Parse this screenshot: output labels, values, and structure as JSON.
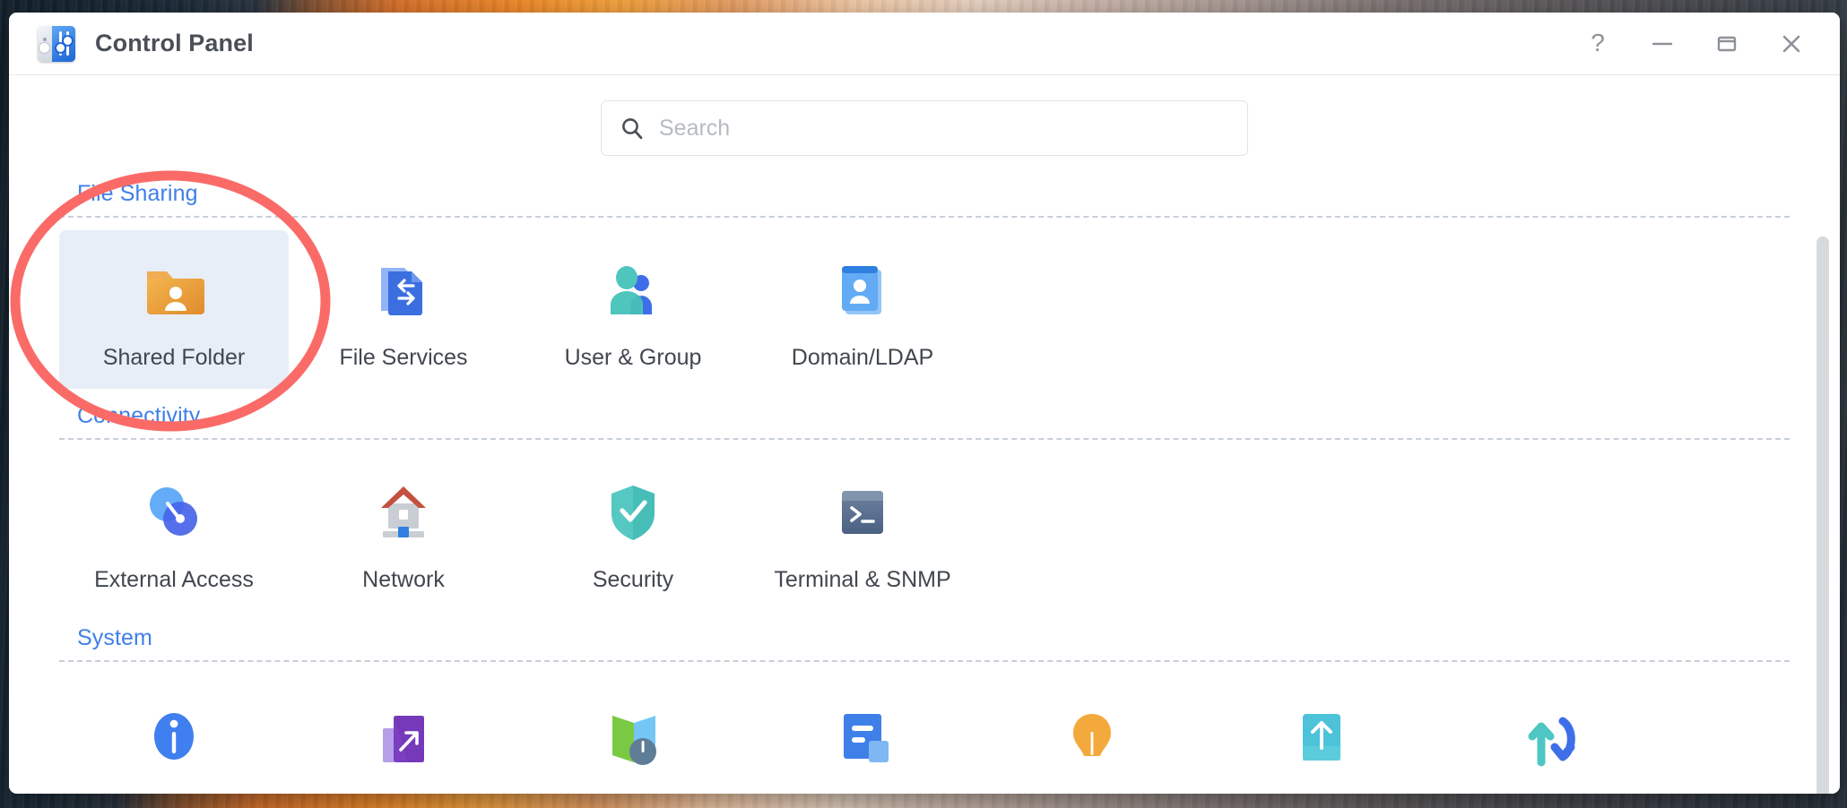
{
  "window": {
    "title": "Control Panel",
    "app_icon": "control-panel-sliders-icon",
    "controls": [
      {
        "name": "help",
        "glyph": "?"
      },
      {
        "name": "minimize",
        "glyph": "—"
      },
      {
        "name": "maximize",
        "glyph": "▭"
      },
      {
        "name": "close",
        "glyph": "✕"
      }
    ]
  },
  "search": {
    "placeholder": "Search",
    "value": "",
    "icon": "search-icon"
  },
  "sections": [
    {
      "id": "file-sharing",
      "title": "File Sharing",
      "items": [
        {
          "id": "shared-folder",
          "label": "Shared Folder",
          "icon": "shared-folder-icon",
          "selected": true
        },
        {
          "id": "file-services",
          "label": "File Services",
          "icon": "file-services-icon",
          "selected": false
        },
        {
          "id": "user-group",
          "label": "User & Group",
          "icon": "user-group-icon",
          "selected": false
        },
        {
          "id": "domain-ldap",
          "label": "Domain/LDAP",
          "icon": "domain-ldap-icon",
          "selected": false
        }
      ]
    },
    {
      "id": "connectivity",
      "title": "Connectivity",
      "items": [
        {
          "id": "external-access",
          "label": "External Access",
          "icon": "external-access-icon",
          "selected": false
        },
        {
          "id": "network",
          "label": "Network",
          "icon": "network-icon",
          "selected": false
        },
        {
          "id": "security",
          "label": "Security",
          "icon": "security-shield-icon",
          "selected": false
        },
        {
          "id": "terminal-snmp",
          "label": "Terminal & SNMP",
          "icon": "terminal-icon",
          "selected": false
        }
      ]
    },
    {
      "id": "system",
      "title": "System",
      "items": [
        {
          "id": "info-center",
          "label": "",
          "icon": "info-icon",
          "selected": false
        },
        {
          "id": "login-portal",
          "label": "",
          "icon": "purple-arrow-icon",
          "selected": false
        },
        {
          "id": "regional-options",
          "label": "",
          "icon": "map-clock-icon",
          "selected": false
        },
        {
          "id": "notification",
          "label": "",
          "icon": "document-lines-icon",
          "selected": false
        },
        {
          "id": "hardware-power",
          "label": "",
          "icon": "lightbulb-icon",
          "selected": false
        },
        {
          "id": "update-restore",
          "label": "",
          "icon": "upload-arrow-icon",
          "selected": false
        },
        {
          "id": "sync",
          "label": "",
          "icon": "up-down-arrows-icon",
          "selected": false
        }
      ]
    }
  ],
  "annotation": {
    "type": "ellipse",
    "target": "shared-folder",
    "color": "#fa6b68",
    "stroke_width": 11
  },
  "scrollbar": {
    "color": "#d7dadd"
  },
  "colors": {
    "section_title": "#3f7fe8",
    "tile_label": "#41474f",
    "selected_tile_bg": "#e8eef8",
    "window_bg": "#ffffff",
    "title_text": "#4a4f57"
  }
}
